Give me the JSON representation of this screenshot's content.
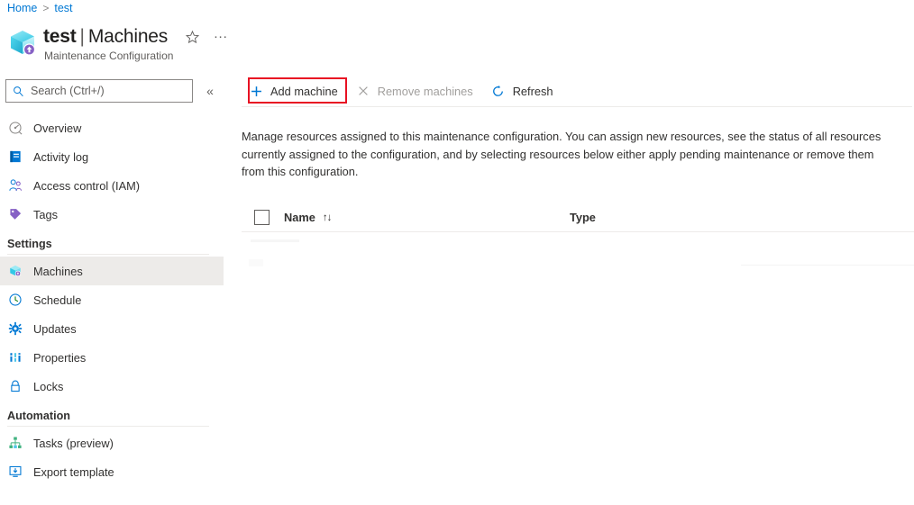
{
  "breadcrumb": {
    "items": [
      {
        "label": "Home",
        "link": true
      },
      {
        "label": "test",
        "link": true
      }
    ],
    "separator": ">"
  },
  "header": {
    "resource_icon": "maintenance-configuration-cube-icon",
    "resource_name": "test",
    "divider": "|",
    "page_name": "Machines",
    "subtitle": "Maintenance Configuration",
    "favorite_icon": "star-outline-icon",
    "more_icon": "ellipsis-icon",
    "more_label": "..."
  },
  "search": {
    "placeholder": "Search (Ctrl+/)",
    "value": "",
    "icon": "search-icon",
    "collapse_icon": "chevron-double-left-icon",
    "collapse_label": "«"
  },
  "sidebar": {
    "top_items": [
      {
        "label": "Overview",
        "icon": "overview-icon",
        "selected": false
      },
      {
        "label": "Activity log",
        "icon": "activity-log-icon",
        "selected": false
      },
      {
        "label": "Access control (IAM)",
        "icon": "access-control-people-icon",
        "selected": false
      },
      {
        "label": "Tags",
        "icon": "tag-icon",
        "selected": false
      }
    ],
    "groups": [
      {
        "heading": "Settings",
        "items": [
          {
            "label": "Machines",
            "icon": "machines-cube-icon",
            "selected": true
          },
          {
            "label": "Schedule",
            "icon": "clock-icon",
            "selected": false
          },
          {
            "label": "Updates",
            "icon": "updates-gear-icon",
            "selected": false
          },
          {
            "label": "Properties",
            "icon": "properties-bars-icon",
            "selected": false
          },
          {
            "label": "Locks",
            "icon": "lock-icon",
            "selected": false
          }
        ]
      },
      {
        "heading": "Automation",
        "items": [
          {
            "label": "Tasks (preview)",
            "icon": "tasks-hierarchy-icon",
            "selected": false
          },
          {
            "label": "Export template",
            "icon": "export-template-icon",
            "selected": false
          }
        ]
      }
    ]
  },
  "toolbar": {
    "add_machine_label": "Add machine",
    "add_machine_icon": "plus-icon",
    "remove_machines_label": "Remove machines",
    "remove_machines_icon": "cross-icon",
    "remove_machines_disabled": true,
    "refresh_label": "Refresh",
    "refresh_icon": "refresh-icon"
  },
  "main": {
    "description": "Manage resources assigned to this maintenance configuration. You can assign new resources, see the status of all resources currently assigned to the configuration, and by selecting resources below either apply pending maintenance or remove them from this configuration."
  },
  "table": {
    "select_all_checkbox": "unchecked",
    "columns": [
      {
        "label": "Name",
        "sortable": true,
        "sort_icon": "↑↓"
      },
      {
        "label": "Type",
        "sortable": true
      }
    ],
    "rows": [],
    "state": "loading"
  },
  "annotation": {
    "type": "red-highlight-rectangle",
    "target": "add-machine-button",
    "color": "#e81123"
  },
  "colors": {
    "accent": "#0078d4",
    "link": "#0078d4",
    "text": "#323130",
    "muted": "#605e5c",
    "disabled": "#a19f9d",
    "selected_bg": "#edebe9",
    "annotation": "#e81123"
  }
}
